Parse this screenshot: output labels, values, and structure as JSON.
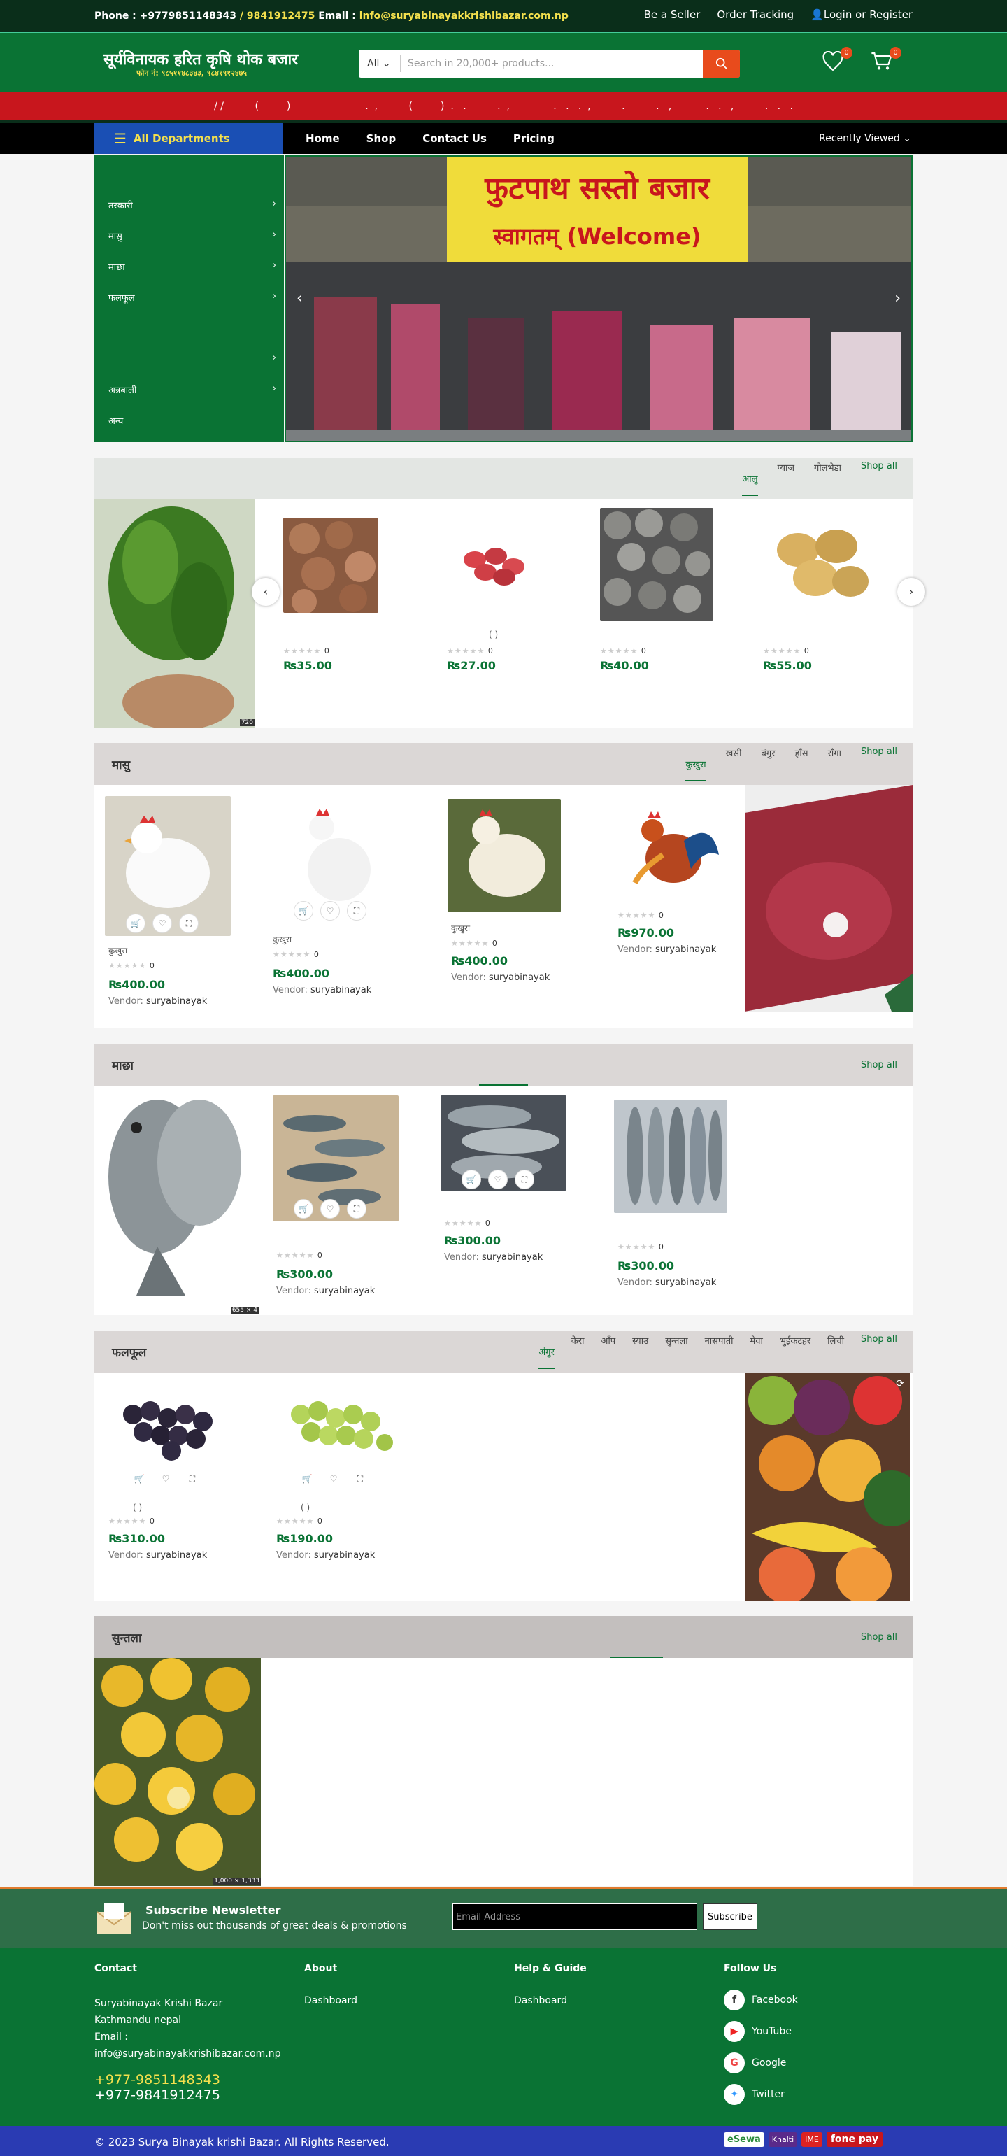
{
  "topbar": {
    "phone_label": "Phone : ",
    "phone1": "+9779851148343",
    "phone_sep": " / ",
    "phone2": "9841912475",
    "email_label": " Email : ",
    "email": "info@suryabinayakkrishibazar.com.np",
    "links": [
      "Be a Seller",
      "Order Tracking",
      "Login or Register"
    ]
  },
  "header": {
    "logo_title": "सूर्यविनायक हरित कृषि थोक बजार",
    "logo_sub": "फोन नं: ९८५११४८३४३, ९८४१९१२४७५",
    "search_category": "All",
    "search_placeholder": "Search in 20,000+ products...",
    "wishlist_count": "0",
    "cart_count": "0"
  },
  "ticker": "/ /          (         )                        .  ,          (         )  .   .          .  ,              .   .   .  ,          .          .   ,           .   .   ,          .   .   .",
  "nav": {
    "all_departments": "All Departments",
    "links": [
      "Home",
      "Shop",
      "Contact Us",
      "Pricing"
    ],
    "recently_viewed": "Recently Viewed"
  },
  "side_menu": [
    "तरकारी",
    "मासु",
    "माछा",
    "फलफूल",
    "",
    "अन्नबाली",
    "अन्य"
  ],
  "hero": {
    "sign_title": "फुटपाथ सस्तो बजार",
    "sign_sub": "स्वागतम् (Welcome)"
  },
  "section1": {
    "tabs": [
      "आलु",
      "प्याज",
      "गोलभेडा"
    ],
    "shop_all": "Shop all",
    "banner_caption": "720",
    "products": [
      {
        "name": "",
        "rating": "0",
        "price": "₨35.00"
      },
      {
        "name": "(            )",
        "rating": "0",
        "price": "₨27.00"
      },
      {
        "name": "",
        "rating": "0",
        "price": "₨40.00"
      },
      {
        "name": "",
        "rating": "0",
        "price": "₨55.00"
      }
    ]
  },
  "section2": {
    "title": "मासु",
    "tabs": [
      "कुखुरा",
      "खसी",
      "बंगुर",
      "हाँस",
      "राँगा"
    ],
    "shop_all": "Shop all",
    "products": [
      {
        "name": "कुखुरा",
        "rating": "0",
        "price": "₨400.00",
        "vendor_label": "Vendor:",
        "vendor": "suryabinayak"
      },
      {
        "name": "कुखुरा",
        "rating": "0",
        "price": "₨400.00",
        "vendor_label": "Vendor:",
        "vendor": "suryabinayak"
      },
      {
        "name": "कुखुरा",
        "rating": "0",
        "price": "₨400.00",
        "vendor_label": "Vendor:",
        "vendor": "suryabinayak"
      },
      {
        "name": "",
        "rating": "0",
        "price": "₨970.00",
        "vendor_label": "Vendor:",
        "vendor": "suryabinayak"
      }
    ]
  },
  "section3": {
    "title": "माछा",
    "shop_all": "Shop all",
    "banner_caption": "655 × 4",
    "products": [
      {
        "rating": "0",
        "price": "₨300.00",
        "vendor_label": "Vendor:",
        "vendor": "suryabinayak"
      },
      {
        "rating": "0",
        "price": "₨300.00",
        "vendor_label": "Vendor:",
        "vendor": "suryabinayak"
      },
      {
        "rating": "0",
        "price": "₨300.00",
        "vendor_label": "Vendor:",
        "vendor": "suryabinayak"
      }
    ]
  },
  "section4": {
    "title": "फलफूल",
    "tabs": [
      "अंगुर",
      "केरा",
      "आँप",
      "स्याउ",
      "सुन्तला",
      "नासपाती",
      "मेवा",
      "भुईकटहर",
      "लिची"
    ],
    "shop_all": "Shop all",
    "products": [
      {
        "name": "(         )",
        "rating": "0",
        "price": "₨310.00",
        "vendor_label": "Vendor:",
        "vendor": "suryabinayak"
      },
      {
        "name": "(         )",
        "rating": "0",
        "price": "₨190.00",
        "vendor_label": "Vendor:",
        "vendor": "suryabinayak"
      }
    ]
  },
  "section5": {
    "title": "सुन्तला",
    "shop_all": "Shop all",
    "banner_caption": "1,000 × 1,333"
  },
  "newsletter": {
    "title": "Subscribe Newsletter",
    "subtitle": "Don't miss out thousands of great deals & promotions",
    "placeholder": "Email Address",
    "button": "Subscribe"
  },
  "footer": {
    "contact_title": "Contact",
    "contact_lines": [
      "Suryabinayak Krishi Bazar",
      "Kathmandu nepal",
      "Email :",
      "info@suryabinayakkrishibazar.com.np"
    ],
    "phone1": "+977-9851148343",
    "phone2": "+977-9841912475",
    "about_title": "About",
    "about_link": "Dashboard",
    "help_title": "Help & Guide",
    "help_link": "Dashboard",
    "follow_title": "Follow Us",
    "social": [
      "Facebook",
      "YouTube",
      "Google",
      "Twitter"
    ],
    "copyright": "© 2023 Surya Binayak krishi Bazar. All Rights Reserved.",
    "payment_logos": [
      "eSewa",
      "Khalti",
      "IME",
      "fone pay"
    ]
  },
  "colors": {
    "brand_green": "#0a7334",
    "dark_green": "#0a2e1a",
    "accent_red": "#c8161d",
    "search_orange": "#e84b1c",
    "nav_blue": "#1a4fb4",
    "bottom_blue": "#2a3bb3"
  }
}
